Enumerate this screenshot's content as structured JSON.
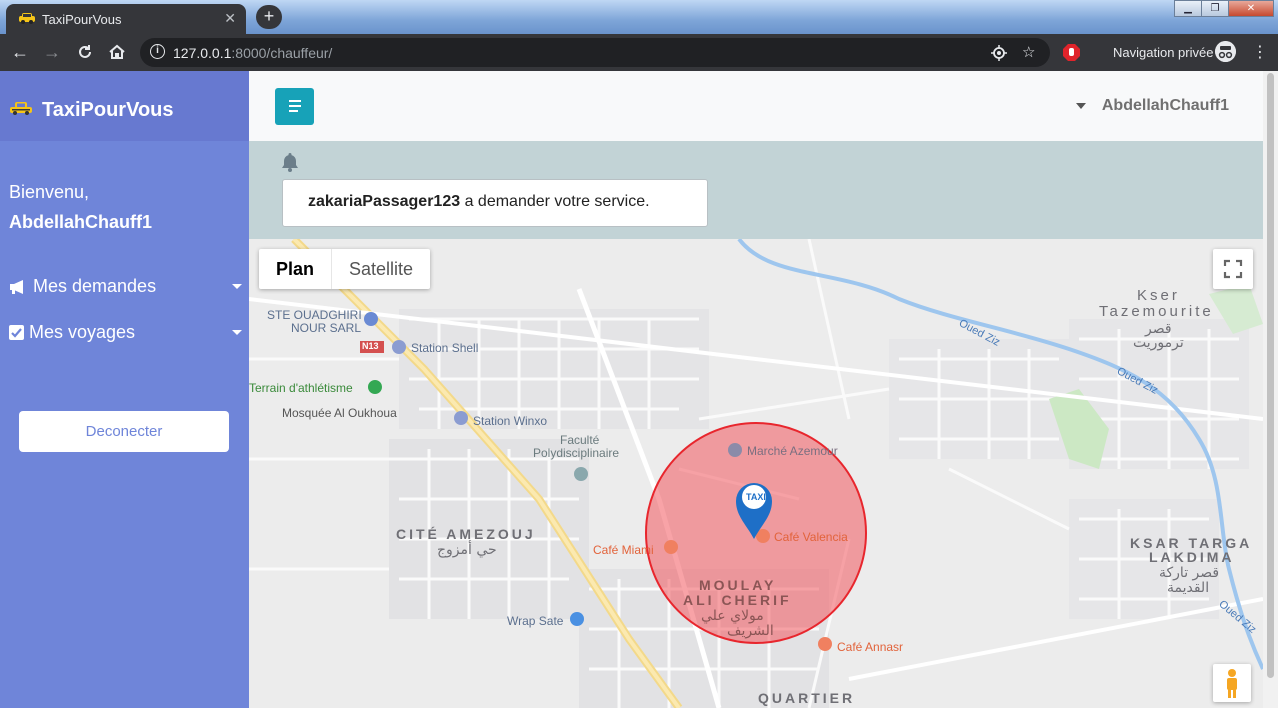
{
  "browser": {
    "tab_title": "TaxiPourVous",
    "url_host": "127.0.0.1",
    "url_rest": ":8000/chauffeur/",
    "private_label": "Navigation privée"
  },
  "sidebar": {
    "brand": "TaxiPourVous",
    "welcome": "Bienvenu,",
    "username": "AbdellahChauff1",
    "menu": [
      {
        "label": "Mes demandes",
        "icon": "megaphone-icon"
      },
      {
        "label": "Mes voyages",
        "icon": "checkbox-icon"
      }
    ],
    "logout_label": "Deconecter"
  },
  "header": {
    "user": "AbdellahChauff1"
  },
  "notification": {
    "sender": "zakariaPassager123",
    "message": " a demander votre service."
  },
  "map": {
    "types": [
      "Plan",
      "Satellite"
    ],
    "selected_type": "Plan",
    "marker_label": "TAXI",
    "circle_color": "#f2575f",
    "labels": {
      "ste": "STE OUADGHIRI",
      "ste2": "NOUR SARL",
      "n13": "N13",
      "shell": "Station Shell",
      "terrain": "Terrain d'athlétisme",
      "mosquee": "Mosquée Al Oukhoua",
      "winxo": "Station Winxo",
      "faculte": "Faculté",
      "faculte2": "Polydisciplinaire",
      "marche": "Marché Azemour",
      "valencia": "Café Valencia",
      "miami": "Café Miami",
      "cite": "CITÉ AMEZOUJ",
      "cite_ar": "حي أمزوج",
      "moulay": "MOULAY",
      "ali": "ALI CHERIF",
      "moulay_ar": "مولاي علي",
      "moulay_ar2": "الشريف",
      "wrap": "Wrap Sate",
      "annasr": "Café Annasr",
      "quartier": "QUARTIER",
      "kser": "Kser",
      "taz": "Tazemourite",
      "taz_ar": "قصر",
      "taz_ar2": "ترموريت",
      "ksar": "KSAR TARGA",
      "lakdima": "LAKDIMA",
      "ksar_ar": "قصر تاركة",
      "ksar_ar2": "القديمة",
      "oued1": "Oued Ziz",
      "oued2": "Oued Ziz",
      "oued3": "Oued Ziz"
    }
  }
}
